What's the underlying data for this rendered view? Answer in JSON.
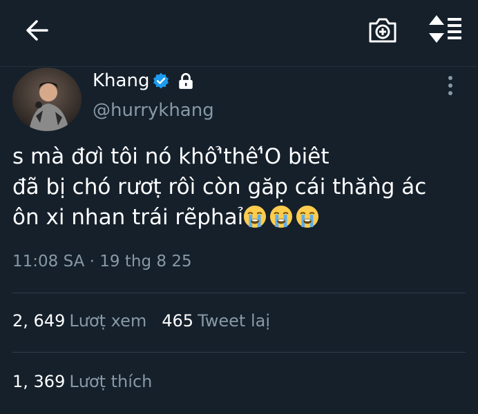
{
  "header": {
    "back_icon": "arrow-left-icon",
    "camera_icon": "camera-plus-icon",
    "sort_icon": "sort-list-icon"
  },
  "author": {
    "display_name": "Khang",
    "handle": "@hurrykhang",
    "verified_icon": "verified-badge-icon",
    "lock_icon": "lock-icon",
    "verified_color": "#1d9bf0"
  },
  "tweet": {
    "lines": [
      "s mà đơì tôi nó khô'̉thê'́O biêt",
      "đã bị chó rươṭ rôì còn găp̣ cái thăǹg ác",
      "ôn xi nhan trái re"
    ],
    "line3_tail": "̃phaỉ",
    "emoji_icon": "loudly-crying-face-icon",
    "timestamp": "11:08 SA · 19 thg 8 25"
  },
  "stats": {
    "views_count": "2, 649",
    "views_label": "Lươṭ xem",
    "retweets_count": "465",
    "retweets_label": "Tweet laị",
    "likes_count": "1, 369",
    "likes_label": "Lươṭ thích"
  },
  "colors": {
    "background": "#15202b",
    "text": "#ffffff",
    "muted": "#8899a6"
  }
}
